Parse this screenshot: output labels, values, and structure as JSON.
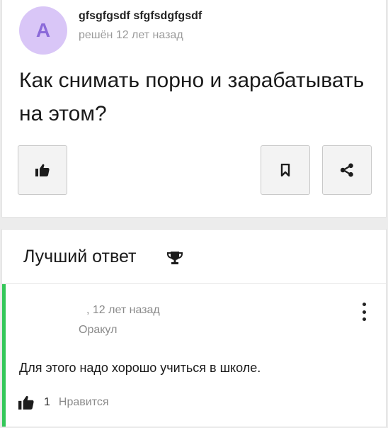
{
  "question": {
    "avatar_letter": "A",
    "author": "gfsgfgsdf sfgfsdgfgsdf",
    "meta": "решён 12 лет назад",
    "title": "Как снимать порно и зарабатывать на этом?",
    "actions": {
      "like_icon": "thumbs-up-icon",
      "bookmark_icon": "bookmark-icon",
      "share_icon": "share-icon"
    }
  },
  "best_answer": {
    "header": "Лучший ответ",
    "header_icon": "trophy-icon",
    "time": ", 12 лет назад",
    "rank": "Оракул",
    "text": "Для этого надо хорошо учиться в школе.",
    "likes": "1",
    "like_label": "Нравится",
    "accent_color": "#34c759"
  }
}
